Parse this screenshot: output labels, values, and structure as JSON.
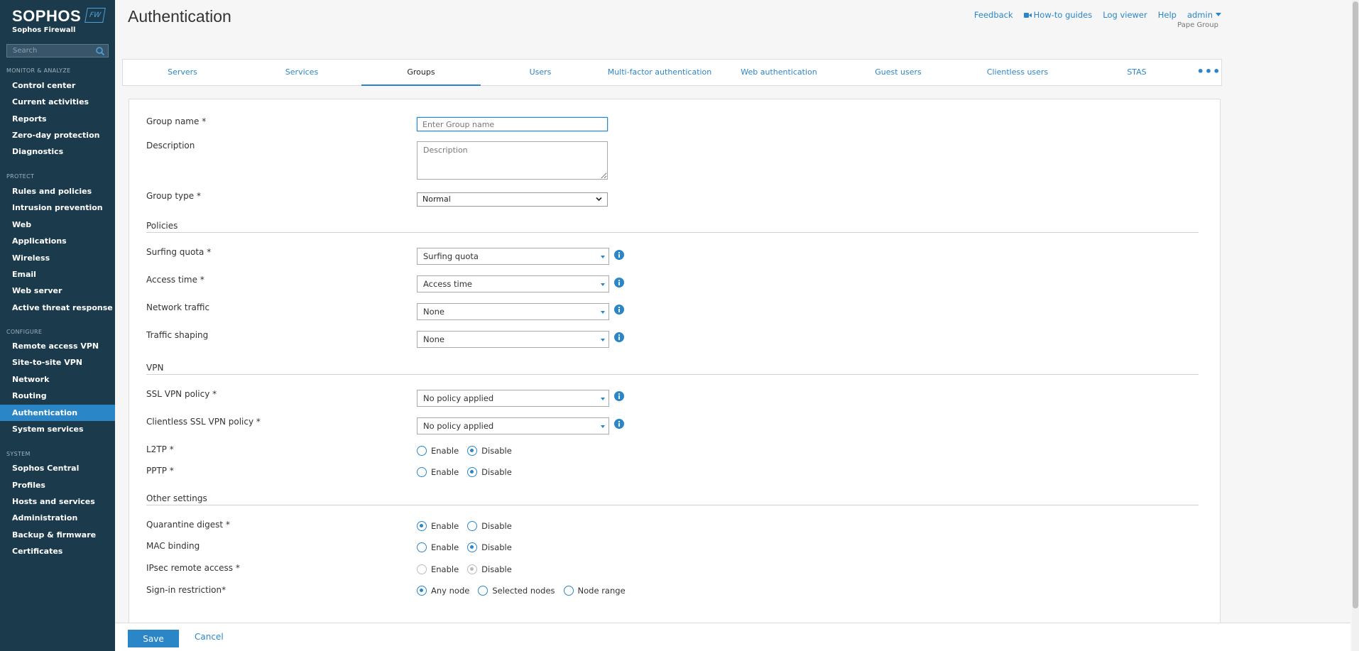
{
  "brand": {
    "name": "SOPHOS",
    "product": "Sophos Firewall",
    "badge": "FW"
  },
  "search": {
    "placeholder": "Search"
  },
  "nav": {
    "monitor_title": "MONITOR & ANALYZE",
    "monitor": [
      "Control center",
      "Current activities",
      "Reports",
      "Zero-day protection",
      "Diagnostics"
    ],
    "protect_title": "PROTECT",
    "protect": [
      "Rules and policies",
      "Intrusion prevention",
      "Web",
      "Applications",
      "Wireless",
      "Email",
      "Web server",
      "Active threat response"
    ],
    "configure_title": "CONFIGURE",
    "configure": [
      "Remote access VPN",
      "Site-to-site VPN",
      "Network",
      "Routing",
      "Authentication",
      "System services"
    ],
    "system_title": "SYSTEM",
    "system": [
      "Sophos Central",
      "Profiles",
      "Hosts and services",
      "Administration",
      "Backup & firmware",
      "Certificates"
    ],
    "active": "Authentication"
  },
  "header": {
    "title": "Authentication",
    "links": {
      "feedback": "Feedback",
      "how_to": "How-to guides",
      "log_viewer": "Log viewer",
      "help": "Help",
      "admin": "admin"
    },
    "org": "Pape Group"
  },
  "tabs": [
    "Servers",
    "Services",
    "Groups",
    "Users",
    "Multi-factor authentication",
    "Web authentication",
    "Guest users",
    "Clientless users",
    "STAS"
  ],
  "tab_more": "•••",
  "active_tab": "Groups",
  "form": {
    "group_name": {
      "label": "Group name *",
      "placeholder": "Enter Group name",
      "value": ""
    },
    "description": {
      "label": "Description",
      "placeholder": "Description"
    },
    "group_type": {
      "label": "Group type *",
      "value": "Normal"
    },
    "policies_title": "Policies",
    "surfing_quota": {
      "label": "Surfing quota *",
      "value": "Surfing quota"
    },
    "access_time": {
      "label": "Access time *",
      "value": "Access time"
    },
    "network_traffic": {
      "label": "Network traffic",
      "value": "None"
    },
    "traffic_shaping": {
      "label": "Traffic shaping",
      "value": "None"
    },
    "vpn_title": "VPN",
    "ssl_vpn": {
      "label": "SSL VPN policy *",
      "value": "No policy applied"
    },
    "clientless_ssl_vpn": {
      "label": "Clientless SSL VPN policy *",
      "value": "No policy applied"
    },
    "l2tp": {
      "label": "L2TP *",
      "enable": "Enable",
      "disable": "Disable",
      "selected": "Disable"
    },
    "pptp": {
      "label": "PPTP *",
      "enable": "Enable",
      "disable": "Disable",
      "selected": "Disable"
    },
    "other_title": "Other settings",
    "quarantine_digest": {
      "label": "Quarantine digest *",
      "enable": "Enable",
      "disable": "Disable",
      "selected": "Enable"
    },
    "mac_binding": {
      "label": "MAC binding",
      "enable": "Enable",
      "disable": "Disable",
      "selected": "Disable"
    },
    "ipsec_remote": {
      "label": "IPsec remote access *",
      "enable": "Enable",
      "disable": "Disable",
      "selected": "Disable"
    },
    "signin_restriction": {
      "label": "Sign-in restriction*",
      "any": "Any node",
      "selected_nodes": "Selected nodes",
      "range": "Node range",
      "selected": "Any node"
    }
  },
  "footer": {
    "save": "Save",
    "cancel": "Cancel"
  },
  "colors": {
    "sidebar": "#1b3a4b",
    "accent": "#2b86c8"
  }
}
